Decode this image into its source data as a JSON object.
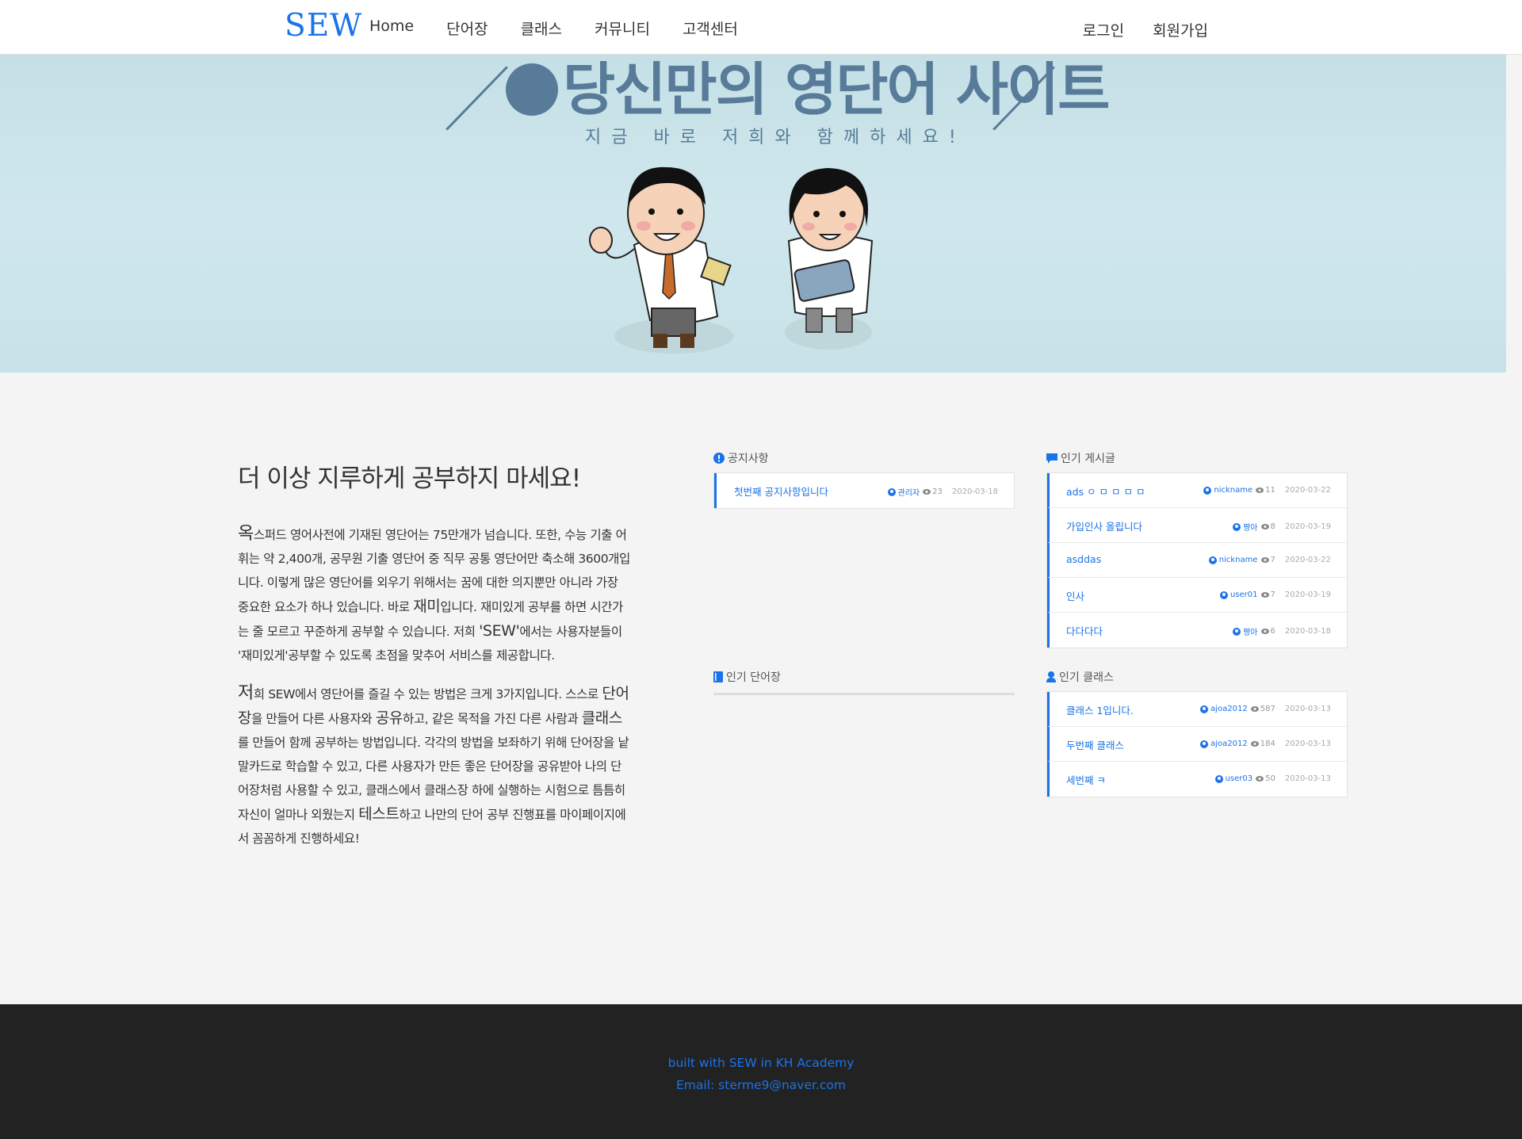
{
  "nav": {
    "brand": "SEW",
    "links": [
      "Home",
      "단어장",
      "클래스",
      "커뮤니티",
      "고객센터"
    ],
    "login": "로그인",
    "signup": "회원가입"
  },
  "hero": {
    "title": "당신만의 영단어 사이트",
    "subtitle": "지금 바로 저희와 함께하세요!"
  },
  "intro": {
    "heading": "더 이상 지루하게 공부하지 마세요!",
    "p1": [
      {
        "t": "옥",
        "c": "big"
      },
      {
        "t": "스퍼드 영어사전에 기재된 영단어는 75만개가 넘습니다. 또한, 수능 기출 어휘는 약 2,400개, 공무원 기출 영단어 중 직무 공통 영단어만 축소해 3600개입니다. 이렇게 많은 영단어를 외우기 위해서는 꿈에 대한 의지뿐만 아니라 가장 중요한 요소가 하나 있습니다. 바로 "
      },
      {
        "t": "재미",
        "c": "mid"
      },
      {
        "t": "입니다. 재미있게 공부를 하면 시간가는 줄 모르고 꾸준하게 공부할 수 있습니다. 저희 "
      },
      {
        "t": "'SEW'",
        "c": "mid"
      },
      {
        "t": "에서는 사용자분들이 '재미있게'공부할 수 있도록 초점을 맞추어 서비스를 제공합니다."
      }
    ],
    "p2": [
      {
        "t": "저",
        "c": "big"
      },
      {
        "t": "희 SEW에서 영단어를 즐길 수 있는 방법은 크게 3가지입니다. 스스로 "
      },
      {
        "t": "단어장",
        "c": "mid"
      },
      {
        "t": "을 만들어 다른 사용자와 "
      },
      {
        "t": "공유",
        "c": "mid"
      },
      {
        "t": "하고, 같은 목적을 가진 다른 사람과 "
      },
      {
        "t": "클래스",
        "c": "mid"
      },
      {
        "t": "를 만들어 함께 공부하는 방법입니다. 각각의 방법을 보좌하기 위해 단어장을 낱말카드로 학습할 수 있고, 다른 사용자가 만든 좋은 단어장을 공유받아 나의 단어장처럼 사용할 수 있고, 클래스에서 클래스장 하에 실행하는 시험으로 틈틈히 자신이 얼마나 외웠는지 "
      },
      {
        "t": "테스트",
        "c": "mid"
      },
      {
        "t": "하고 나만의 단어 공부 진행표를 마이페이지에서 꼼꼼하게 진행하세요!"
      }
    ]
  },
  "boards": {
    "notice": {
      "title": "공지사항",
      "rows": [
        {
          "title": "첫번째 공지사항입니다",
          "author": "관리자",
          "views": "23",
          "date": "2020-03-18"
        }
      ]
    },
    "popular_posts": {
      "title": "인기 게시글",
      "rows": [
        {
          "title": "ads ㅇ ㅁ ㅁ ㅁ ㅁ",
          "author": "nickname",
          "views": "11",
          "date": "2020-03-22"
        },
        {
          "title": "가입인사 올립니다",
          "author": "짱아",
          "views": "8",
          "date": "2020-03-19"
        },
        {
          "title": "asddas",
          "author": "nickname",
          "views": "7",
          "date": "2020-03-22"
        },
        {
          "title": "인사",
          "author": "user01",
          "views": "7",
          "date": "2020-03-19"
        },
        {
          "title": "다다다다",
          "author": "짱아",
          "views": "6",
          "date": "2020-03-18"
        }
      ]
    },
    "popular_wordbooks": {
      "title": "인기 단어장",
      "rows": []
    },
    "popular_classes": {
      "title": "인기 클래스",
      "rows": [
        {
          "title": "클래스 1입니다.",
          "author": "ajoa2012",
          "views": "587",
          "date": "2020-03-13"
        },
        {
          "title": "두번째 클래스",
          "author": "ajoa2012",
          "views": "184",
          "date": "2020-03-13"
        },
        {
          "title": "세번째 ㅋ",
          "author": "user03",
          "views": "50",
          "date": "2020-03-13"
        }
      ]
    }
  },
  "footer": {
    "line1": "built with SEW in KH Academy",
    "line2": "Email: sterme9@naver.com"
  },
  "colors": {
    "accent": "#1a73e8",
    "hero_bg": "#c9e4ea",
    "hero_text": "#587b99",
    "footer_bg": "#222222"
  }
}
